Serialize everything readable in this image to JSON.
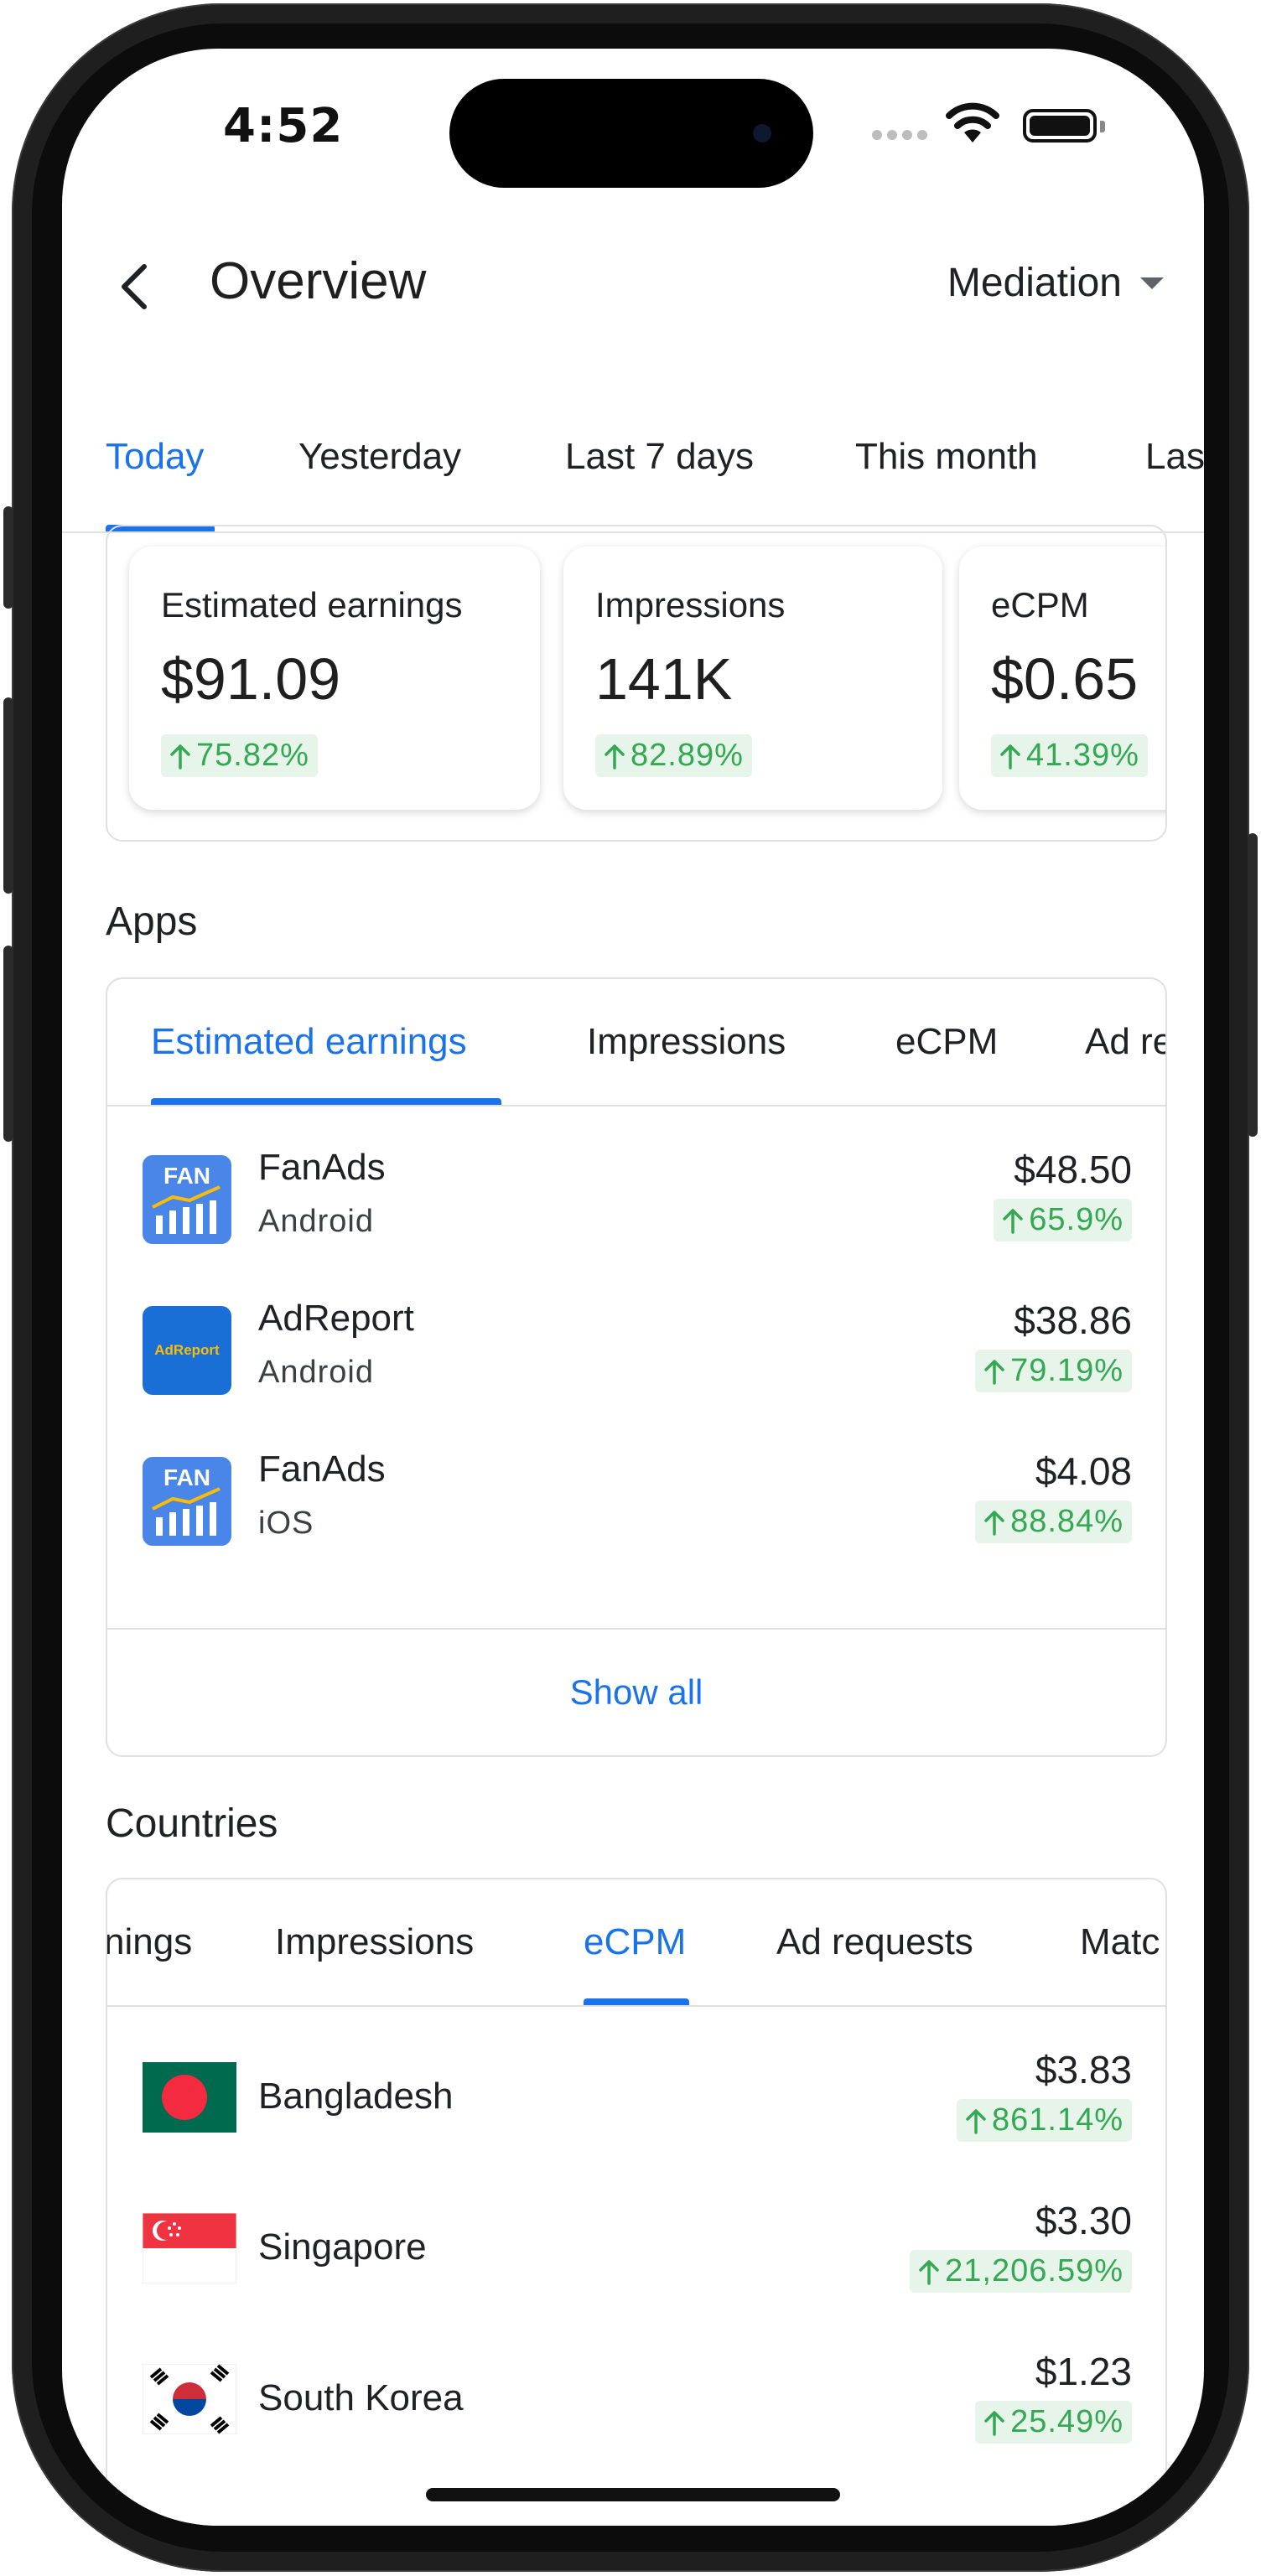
{
  "status_bar": {
    "time": "4:52"
  },
  "header": {
    "title": "Overview",
    "mode": "Mediation"
  },
  "date_tabs": [
    "Today",
    "Yesterday",
    "Last 7 days",
    "This month",
    "Las"
  ],
  "summary": [
    {
      "label": "Estimated earnings",
      "value": "$91.09",
      "change": "75.82%"
    },
    {
      "label": "Impressions",
      "value": "141K",
      "change": "82.89%"
    },
    {
      "label": "eCPM",
      "value": "$0.65",
      "change": "41.39%"
    }
  ],
  "apps": {
    "title": "Apps",
    "tabs": [
      "Estimated earnings",
      "Impressions",
      "eCPM",
      "Ad re"
    ],
    "rows": [
      {
        "name": "FanAds",
        "platform": "Android",
        "value": "$48.50",
        "change": "65.9%",
        "icon": "fanads-icon",
        "icon_text": "FAN"
      },
      {
        "name": "AdReport",
        "platform": "Android",
        "value": "$38.86",
        "change": "79.19%",
        "icon": "adreport-icon",
        "icon_text": "AdReport"
      },
      {
        "name": "FanAds",
        "platform": "iOS",
        "value": "$4.08",
        "change": "88.84%",
        "icon": "fanads-icon",
        "icon_text": "FAN"
      }
    ],
    "show_all": "Show all"
  },
  "countries": {
    "title": "Countries",
    "tabs": [
      "nings",
      "Impressions",
      "eCPM",
      "Ad requests",
      "Matc"
    ],
    "rows": [
      {
        "name": "Bangladesh",
        "value": "$3.83",
        "change": "861.14%"
      },
      {
        "name": "Singapore",
        "value": "$3.30",
        "change": "21,206.59%"
      },
      {
        "name": "South Korea",
        "value": "$1.23",
        "change": "25.49%"
      }
    ]
  },
  "colors": {
    "accent": "#1a73e8",
    "positive": "#34a853",
    "positive_bg": "#e6f4ea"
  }
}
